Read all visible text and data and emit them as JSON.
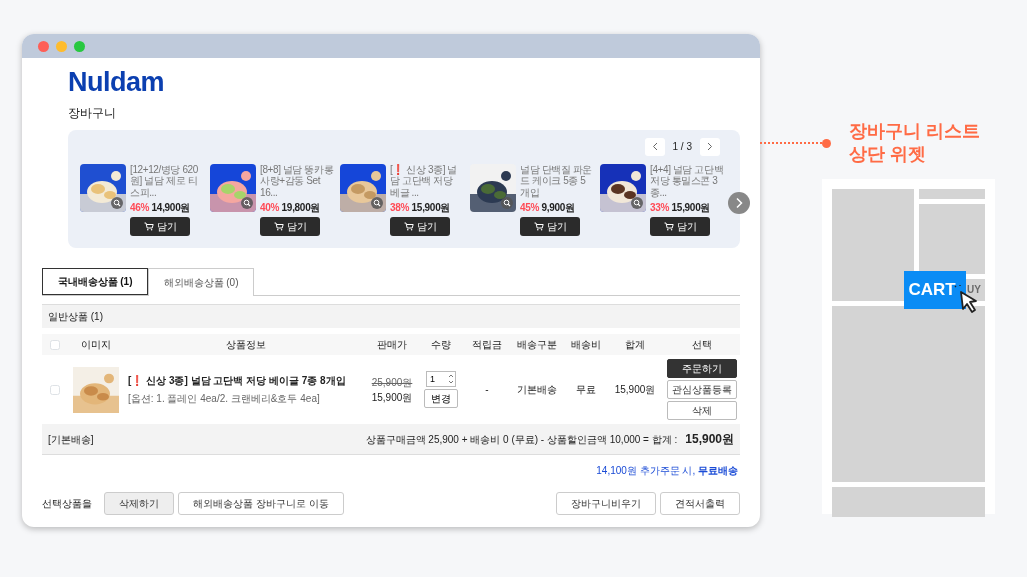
{
  "window": {
    "buttons": [
      {
        "color": "#fe5f57"
      },
      {
        "color": "#febc2e"
      },
      {
        "color": "#28c840"
      }
    ]
  },
  "logo": "Nuldam",
  "page_title": "장바구니",
  "carousel": {
    "pager": "1 / 3",
    "products": [
      {
        "name": "[12+12/병당 620원] 널담 제로 티스피...",
        "discount": "46%",
        "price": "14,900원",
        "button": "담기",
        "kind": "picture"
      },
      {
        "name": "[8+8] 널담 뚱카롱 사랑+감동 Set 16...",
        "discount": "40%",
        "price": "19,800원",
        "button": "담기",
        "kind": "picture"
      },
      {
        "name": "[❗ 신상 3종] 널담 고단백 저당 베글 ...",
        "discount": "38%",
        "price": "15,900원",
        "button": "담기",
        "kind": "picture"
      },
      {
        "name": "널담 단백질 파운드 케이크 5종 5개입",
        "discount": "45%",
        "price": "9,900원",
        "button": "담기",
        "kind": "picture"
      },
      {
        "name": "[4+4] 널담 고단백 저당 통밀스콘 3종...",
        "discount": "33%",
        "price": "15,900원",
        "button": "담기",
        "kind": "picture"
      }
    ]
  },
  "tabs": [
    {
      "label": "국내배송상품 (1)",
      "selected": true
    },
    {
      "label": "해외배송상품 (0)",
      "selected": false
    }
  ],
  "section_title": "일반상품 (1)",
  "table": {
    "header_checked": false,
    "columns": [
      "이미지",
      "상품정보",
      "판매가",
      "수량",
      "적립금",
      "배송구분",
      "배송비",
      "합계",
      "선택"
    ],
    "rows": [
      {
        "checked": false,
        "name": "[❗ 신상 3종] 널담 고단백 저당 베이글 7종 8개입",
        "option": "[옵션: 1. 플레인 4ea/2. 크랜베리&호두 4ea]",
        "original_price": "25,900원",
        "price": "15,900원",
        "quantity": "1",
        "change_button": "변경",
        "points": "-",
        "shipping_type": "기본배송",
        "shipping_fee": "무료",
        "total": "15,900원",
        "actions": [
          {
            "label": "주문하기",
            "kind": "primary"
          },
          {
            "label": "관심상품등록",
            "kind": "default"
          },
          {
            "label": "삭제",
            "kind": "default"
          }
        ]
      }
    ]
  },
  "summary": {
    "label": "[기본배송]",
    "formula": "상품구매금액 25,900 + 배송비 0 (무료) - 상품할인금액 10,000 = 합계 :",
    "total": "15,900원"
  },
  "free_shipping": "14,100원 추가주문 시, **무료배송**",
  "bottom": {
    "label": "선택상품을",
    "left_buttons": [
      {
        "label": "삭제하기",
        "kind": "filled"
      },
      {
        "label": "해외배송상품 장바구니로 이동",
        "kind": "default"
      }
    ],
    "right_buttons": [
      {
        "label": "장바구니비우기"
      },
      {
        "label": "견적서출력"
      }
    ]
  },
  "annotation": {
    "text": "장바구니 리스트\n상단 위젯"
  },
  "wireframe": {
    "cart_label": "CART",
    "hidden_label": "UY"
  }
}
